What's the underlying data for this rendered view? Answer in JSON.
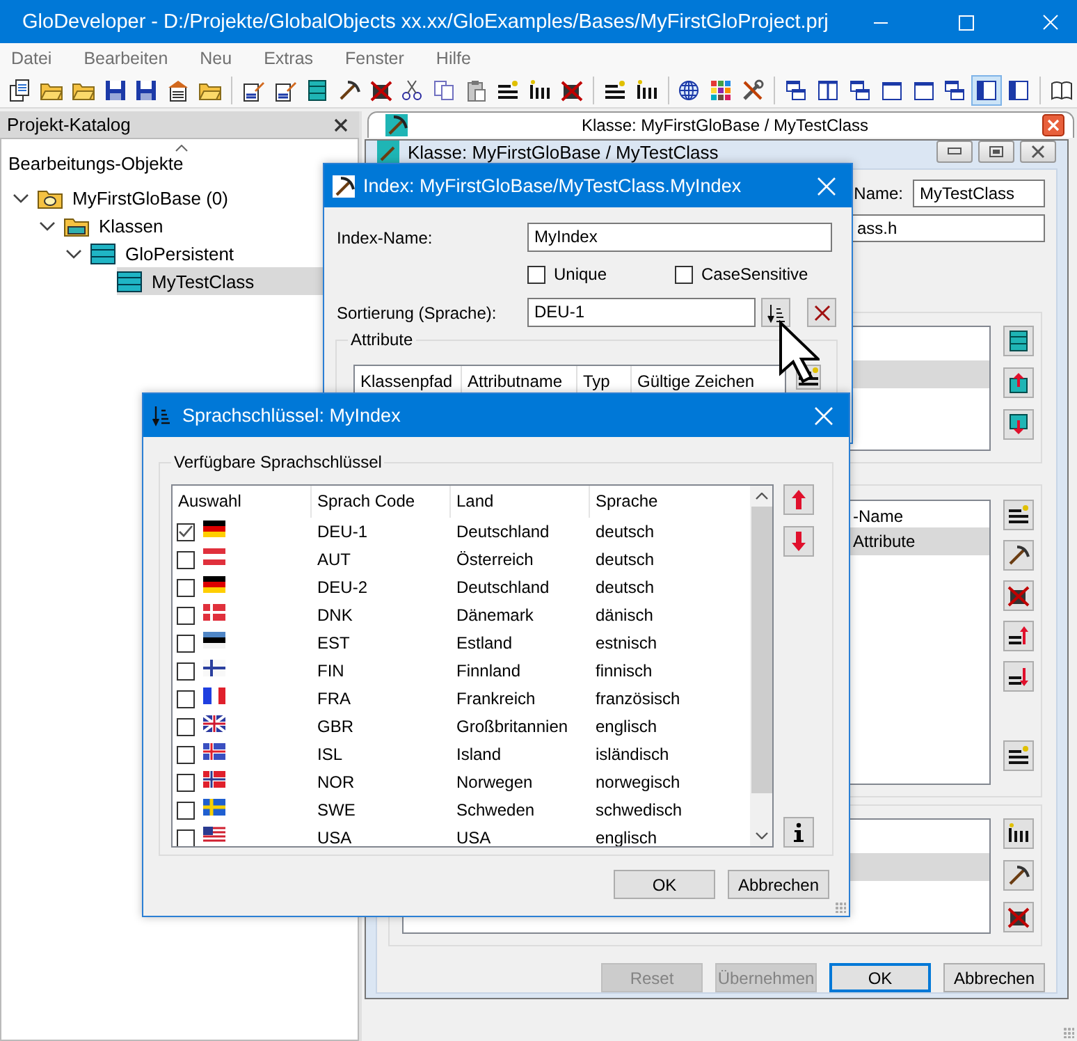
{
  "window": {
    "title": "GloDeveloper - D:/Projekte/GlobalObjects xx.xx/GloExamples/Bases/MyFirstGloProject.prj"
  },
  "menu": [
    {
      "label": "Datei",
      "disabled": true
    },
    {
      "label": "Bearbeiten",
      "disabled": true
    },
    {
      "label": "Neu",
      "disabled": true
    },
    {
      "label": "Extras",
      "disabled": true
    },
    {
      "label": "Fenster",
      "disabled": true
    },
    {
      "label": "Hilfe",
      "disabled": true
    }
  ],
  "toolbar": [
    {
      "kind": "documents",
      "pressed": false
    },
    {
      "kind": "folder",
      "pressed": false
    },
    {
      "kind": "folder",
      "pressed": false
    },
    {
      "kind": "save",
      "pressed": false
    },
    {
      "kind": "save",
      "pressed": false
    },
    {
      "kind": "properties",
      "pressed": false
    },
    {
      "kind": "folder",
      "pressed": false
    },
    {
      "kind": "separator"
    },
    {
      "kind": "pencil",
      "pressed": false
    },
    {
      "kind": "pencil",
      "pressed": false
    },
    {
      "kind": "table",
      "pressed": false
    },
    {
      "kind": "pickaxe",
      "pressed": false
    },
    {
      "kind": "delete",
      "pressed": false
    },
    {
      "kind": "cut",
      "pressed": false
    },
    {
      "kind": "copy",
      "pressed": false
    },
    {
      "kind": "paste",
      "pressed": false
    },
    {
      "kind": "attribute",
      "pressed": false
    },
    {
      "kind": "index",
      "pressed": false
    },
    {
      "kind": "delete",
      "pressed": false
    },
    {
      "kind": "separator"
    },
    {
      "kind": "attribute",
      "pressed": false
    },
    {
      "kind": "index",
      "pressed": false
    },
    {
      "kind": "separator"
    },
    {
      "kind": "globe",
      "pressed": false
    },
    {
      "kind": "palette",
      "pressed": false
    },
    {
      "kind": "tools",
      "pressed": false
    },
    {
      "kind": "separator"
    },
    {
      "kind": "cascade",
      "pressed": false
    },
    {
      "kind": "split",
      "pressed": false
    },
    {
      "kind": "cascade",
      "pressed": false
    },
    {
      "kind": "window",
      "pressed": false
    },
    {
      "kind": "window",
      "pressed": false
    },
    {
      "kind": "cascade",
      "pressed": false
    },
    {
      "kind": "panel",
      "pressed": true
    },
    {
      "kind": "panel",
      "pressed": false
    },
    {
      "kind": "separator"
    },
    {
      "kind": "book",
      "pressed": false
    }
  ],
  "project_panel": {
    "title": "Projekt-Katalog",
    "column": "Bearbeitungs-Objekte",
    "tree": [
      {
        "label": "MyFirstGloBase (0)",
        "kind": "database",
        "expanded": true,
        "selected": false,
        "children": [
          {
            "label": "Klassen",
            "kind": "folder",
            "expanded": true,
            "selected": false,
            "children": [
              {
                "label": "GloPersistent",
                "kind": "class",
                "expanded": true,
                "selected": false,
                "children": [
                  {
                    "label": "MyTestClass",
                    "kind": "class",
                    "selected": true
                  }
                ]
              }
            ]
          }
        ]
      }
    ]
  },
  "document_tab": {
    "title": "Klasse: MyFirstGloBase / MyTestClass"
  },
  "class_window": {
    "title": "Klasse: MyFirstGloBase / MyTestClass",
    "name_label": "Name:",
    "name_value": "MyTestClass",
    "file_value": "ass.h",
    "list_1": {
      "rows": [
        {
          "selected": false
        },
        {
          "selected": true
        }
      ]
    },
    "list_2": {
      "column": "-Name",
      "rows": [
        {
          "label": "Attribute",
          "selected": true
        }
      ]
    },
    "list_3": {
      "rows": [
        {
          "selected": false
        },
        {
          "selected": true
        }
      ]
    },
    "buttons": [
      {
        "label": "Reset",
        "disabled": true,
        "default": false
      },
      {
        "label": "Übernehmen",
        "disabled": true,
        "default": false
      },
      {
        "label": "OK",
        "disabled": false,
        "default": true
      },
      {
        "label": "Abbrechen",
        "disabled": false,
        "default": false
      }
    ]
  },
  "index_dialog": {
    "title": "Index: MyFirstGloBase/MyTestClass.MyIndex",
    "name_label": "Index-Name:",
    "name_value": "MyIndex",
    "options": [
      {
        "label": "Unique",
        "checked": false
      },
      {
        "label": "CaseSensitive",
        "checked": false
      }
    ],
    "sort_label": "Sortierung (Sprache):",
    "sort_value": "DEU-1",
    "attributes": {
      "title": "Attribute",
      "columns": [
        "Klassenpfad",
        "Attributname",
        "Typ",
        "Gültige Zeichen"
      ]
    }
  },
  "language_dialog": {
    "title": "Sprachschlüssel: MyIndex",
    "group": "Verfügbare Sprachschlüssel",
    "columns": [
      "Auswahl",
      "Sprach Code",
      "Land",
      "Sprache"
    ],
    "rows": [
      {
        "kind": "de",
        "checked": true,
        "code": "DEU-1",
        "country": "Deutschland",
        "language": "deutsch"
      },
      {
        "kind": "at",
        "checked": false,
        "code": "AUT",
        "country": "Österreich",
        "language": "deutsch"
      },
      {
        "kind": "de",
        "checked": false,
        "code": "DEU-2",
        "country": "Deutschland",
        "language": "deutsch"
      },
      {
        "kind": "dk",
        "checked": false,
        "code": "DNK",
        "country": "Dänemark",
        "language": "dänisch"
      },
      {
        "kind": "ee",
        "checked": false,
        "code": "EST",
        "country": "Estland",
        "language": "estnisch"
      },
      {
        "kind": "fi",
        "checked": false,
        "code": "FIN",
        "country": "Finnland",
        "language": "finnisch"
      },
      {
        "kind": "fr",
        "checked": false,
        "code": "FRA",
        "country": "Frankreich",
        "language": "französisch"
      },
      {
        "kind": "gb",
        "checked": false,
        "code": "GBR",
        "country": "Großbritannien",
        "language": "englisch"
      },
      {
        "kind": "is",
        "checked": false,
        "code": "ISL",
        "country": "Island",
        "language": "isländisch"
      },
      {
        "kind": "no",
        "checked": false,
        "code": "NOR",
        "country": "Norwegen",
        "language": "norwegisch"
      },
      {
        "kind": "se",
        "checked": false,
        "code": "SWE",
        "country": "Schweden",
        "language": "schwedisch"
      },
      {
        "kind": "us",
        "checked": false,
        "code": "USA",
        "country": "USA",
        "language": "englisch"
      }
    ],
    "buttons": [
      {
        "label": "OK"
      },
      {
        "label": "Abbrechen"
      }
    ]
  }
}
